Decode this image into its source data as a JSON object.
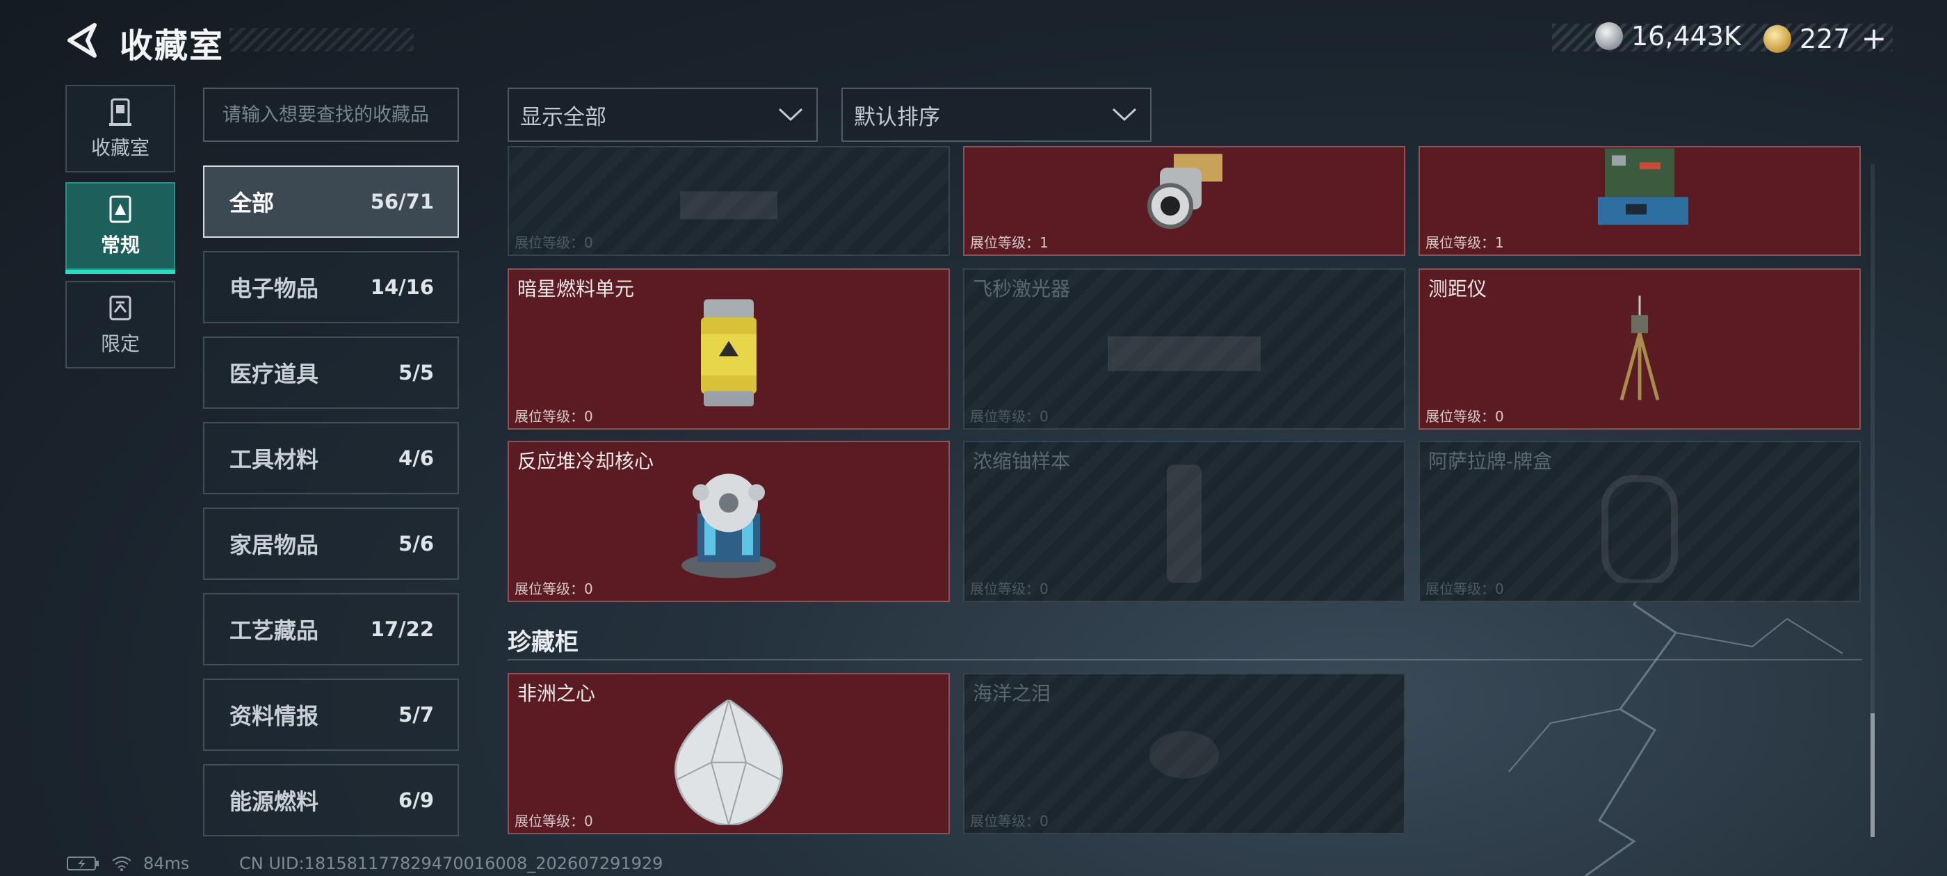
{
  "header": {
    "title": "收藏室",
    "currencies": [
      {
        "icon": "silver-coin-icon",
        "value": "16,443K"
      },
      {
        "icon": "gold-coin-icon",
        "value": "227"
      }
    ],
    "plus_label": "+"
  },
  "rail": {
    "tabs": [
      {
        "label": "收藏室",
        "icon": "collection-room-icon"
      },
      {
        "label": "常规",
        "icon": "regular-icon",
        "active": true
      },
      {
        "label": "限定",
        "icon": "limited-icon"
      }
    ]
  },
  "search": {
    "placeholder": "请输入想要查找的收藏品"
  },
  "filters": {
    "display": "显示全部",
    "sort": "默认排序"
  },
  "categories": [
    {
      "name": "全部",
      "count": "56/71",
      "active": true
    },
    {
      "name": "电子物品",
      "count": "14/16"
    },
    {
      "name": "医疗道具",
      "count": "5/5"
    },
    {
      "name": "工具材料",
      "count": "4/6"
    },
    {
      "name": "家居物品",
      "count": "5/6"
    },
    {
      "name": "工艺藏品",
      "count": "17/22"
    },
    {
      "name": "资料情报",
      "count": "5/7"
    },
    {
      "name": "能源燃料",
      "count": "6/9"
    }
  ],
  "grid": {
    "level_prefix": "展位等级：",
    "rows": [
      [
        {
          "name": "",
          "level": "0",
          "owned": false,
          "art": "device-icon"
        },
        {
          "name": "",
          "level": "1",
          "owned": true,
          "art": "lens-device-icon"
        },
        {
          "name": "",
          "level": "1",
          "owned": true,
          "art": "circuit-box-icon"
        }
      ],
      [
        {
          "name": "暗星燃料单元",
          "level": "0",
          "owned": true,
          "art": "fuel-canister-icon"
        },
        {
          "name": "飞秒激光器",
          "level": "0",
          "owned": false,
          "art": "laser-box-icon"
        },
        {
          "name": "测距仪",
          "level": "0",
          "owned": true,
          "art": "tripod-icon"
        }
      ],
      [
        {
          "name": "反应堆冷却核心",
          "level": "0",
          "owned": true,
          "art": "reactor-core-icon"
        },
        {
          "name": "浓缩铀样本",
          "level": "0",
          "owned": false,
          "art": "uranium-tube-icon"
        },
        {
          "name": "阿萨拉牌-牌盒",
          "level": "0",
          "owned": false,
          "art": "card-box-icon"
        }
      ]
    ]
  },
  "showcase": {
    "title": "珍藏柜",
    "items": [
      {
        "name": "非洲之心",
        "level": "0",
        "owned": true,
        "art": "diamond-icon"
      },
      {
        "name": "海洋之泪",
        "level": "0",
        "owned": false,
        "art": "sea-gem-icon"
      }
    ]
  },
  "footer": {
    "ping": "84ms",
    "uid": "CN UID:1815811778294700160​08_202607291929"
  }
}
